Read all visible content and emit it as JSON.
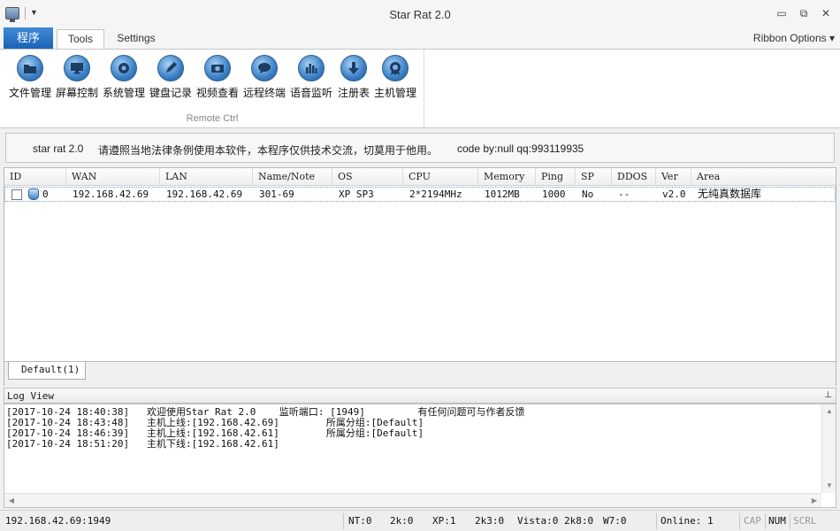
{
  "window": {
    "title": "Star Rat 2.0",
    "minimize_glyph": "▭",
    "restore_glyph": "⧉",
    "close_glyph": "✕"
  },
  "ribbon": {
    "file_tab": "程序",
    "tabs": [
      "Tools",
      "Settings"
    ],
    "options_label": "Ribbon Options ▾",
    "group_label": "Remote Ctrl",
    "buttons": [
      {
        "label": "文件管理",
        "icon": "folder-icon"
      },
      {
        "label": "屏幕控制",
        "icon": "monitor-icon"
      },
      {
        "label": "系统管理",
        "icon": "gear-icon"
      },
      {
        "label": "键盘记录",
        "icon": "pencil-icon"
      },
      {
        "label": "视频查看",
        "icon": "camera-icon"
      },
      {
        "label": "远程终端",
        "icon": "chat-bubble-icon"
      },
      {
        "label": "语音监听",
        "icon": "equalizer-icon"
      },
      {
        "label": "注册表",
        "icon": "download-arrow-icon"
      },
      {
        "label": "主机管理",
        "icon": "badge-icon"
      }
    ]
  },
  "notice": {
    "app": "star rat 2.0",
    "message": "请遵照当地法律条例使用本软件，本程序仅供技术交流，切莫用于他用。",
    "credit": "code by:null qq:993119935"
  },
  "hosts": {
    "columns": [
      "ID",
      "WAN",
      "LAN",
      "Name/Note",
      "OS",
      "CPU",
      "Memory",
      "Ping",
      "SP",
      "DDOS",
      "Ver",
      "Area"
    ],
    "rows": [
      {
        "id": "0",
        "wan": "192.168.42.69",
        "lan": "192.168.42.69",
        "name": "301-69",
        "os": "XP SP3",
        "cpu": "2*2194MHz",
        "memory": "1012MB",
        "ping": "1000",
        "sp": "No",
        "ddos": "--",
        "ver": "v2.0",
        "area": "无纯真数据库"
      }
    ]
  },
  "group_tab": "Default(1)",
  "log": {
    "title": "Log View",
    "pin_glyph": "⊥",
    "lines": [
      "[2017-10-24 18:40:38]   欢迎使用Star Rat 2.0    监听端口: [1949]         有任何问题可与作者反馈",
      "[2017-10-24 18:43:48]   主机上线:[192.168.42.69]        所属分组:[Default]",
      "[2017-10-24 18:46:39]   主机上线:[192.168.42.61]        所属分组:[Default]",
      "[2017-10-24 18:51:20]   主机下线:[192.168.42.61]"
    ]
  },
  "statusbar": {
    "address": "192.168.42.69:1949",
    "nt": "NT:0",
    "k2": "2k:0",
    "xp": "XP:1",
    "k3": "2k3:0",
    "vista": "Vista:0 2k8:0",
    "w7": "W7:0",
    "online": "Online: 1",
    "cap": "CAP",
    "num": "NUM",
    "scrl": "SCRL"
  }
}
